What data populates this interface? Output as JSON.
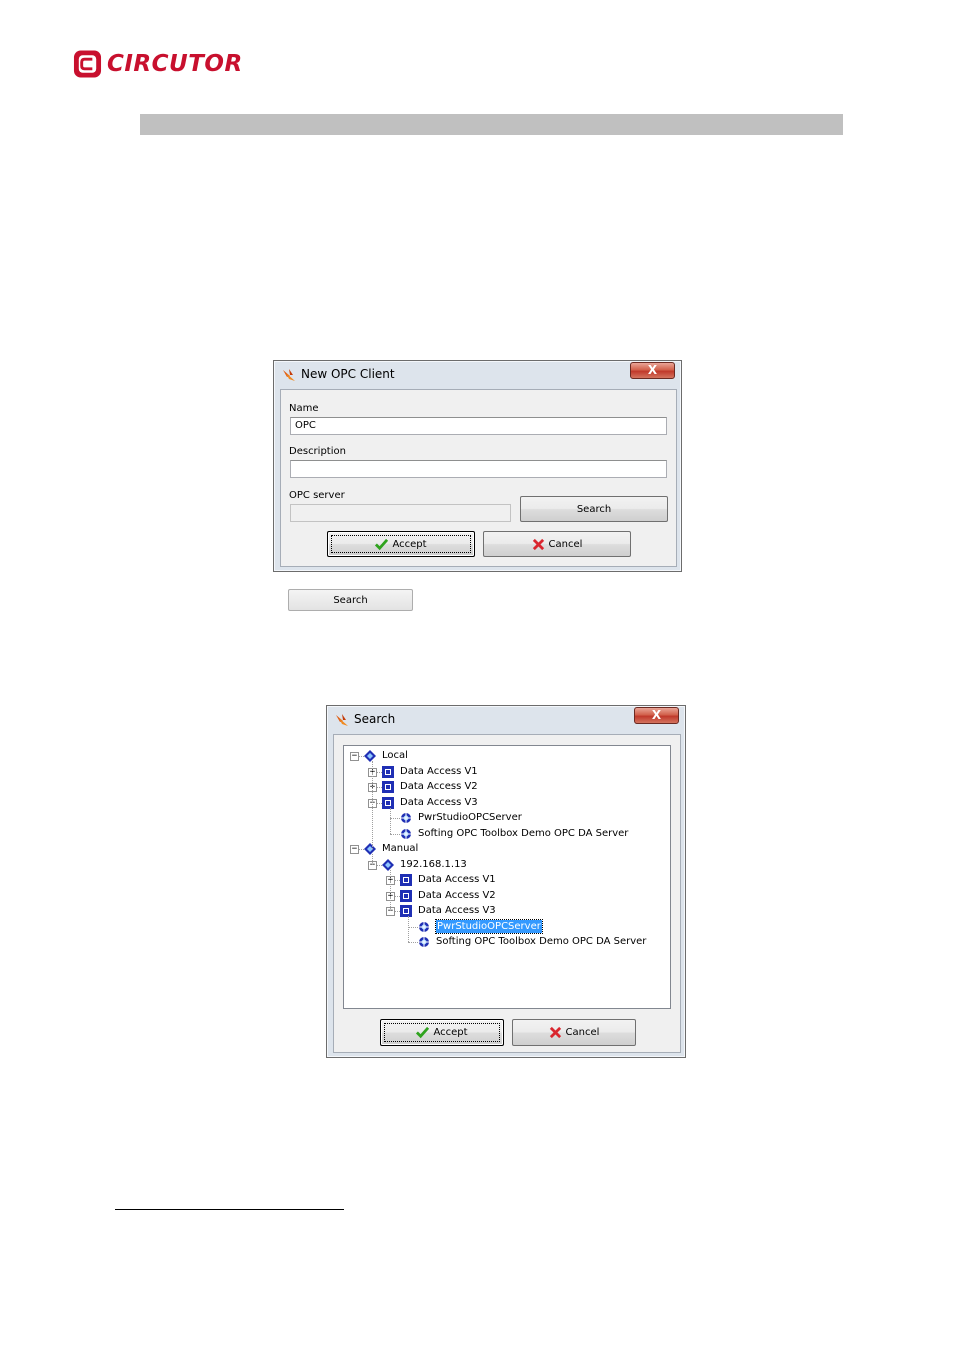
{
  "brand": {
    "name": "CIRCUTOR",
    "color": "#c8102e"
  },
  "dialog_new_client": {
    "title": "New OPC Client",
    "close_label": "X",
    "name_label": "Name",
    "name_value": "OPC",
    "description_label": "Description",
    "description_value": "",
    "server_label": "OPC server",
    "server_value": "",
    "search_label": "Search",
    "accept_label": "Accept",
    "cancel_label": "Cancel"
  },
  "inline_search_label": "Search",
  "dialog_search": {
    "title": "Search",
    "close_label": "X",
    "accept_label": "Accept",
    "cancel_label": "Cancel",
    "tree": [
      {
        "label": "Local",
        "icon": "diamond-icon",
        "expander": "minus"
      },
      {
        "label": "Data Access V1",
        "icon": "square-icon",
        "expander": "plus"
      },
      {
        "label": "Data Access V2",
        "icon": "square-icon",
        "expander": "plus"
      },
      {
        "label": "Data Access V3",
        "icon": "square-icon",
        "expander": "minus"
      },
      {
        "label": "PwrStudioOPCServer",
        "icon": "server-icon"
      },
      {
        "label": "Softing OPC Toolbox Demo OPC DA Server",
        "icon": "server-icon"
      },
      {
        "label": "Manual",
        "icon": "diamond-icon",
        "expander": "minus"
      },
      {
        "label": "192.168.1.13",
        "icon": "diamond-icon",
        "expander": "minus"
      },
      {
        "label": "Data Access V1",
        "icon": "square-icon",
        "expander": "plus"
      },
      {
        "label": "Data Access V2",
        "icon": "square-icon",
        "expander": "plus"
      },
      {
        "label": "Data Access V3",
        "icon": "square-icon",
        "expander": "minus"
      },
      {
        "label": "PwrStudioOPCServer",
        "icon": "server-icon",
        "selected": true
      },
      {
        "label": "Softing OPC Toolbox Demo OPC DA Server",
        "icon": "server-icon"
      }
    ]
  },
  "colors": {
    "selection": "#3399ff",
    "tree_icon": "#1f2fb4",
    "accept_check": "#2fa31e",
    "cancel_x": "#d9262e"
  }
}
